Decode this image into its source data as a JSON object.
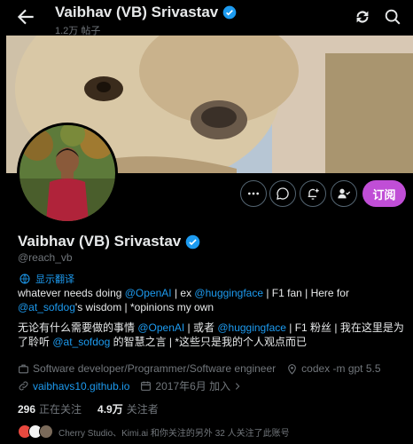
{
  "header": {
    "title": "Vaibhav (VB) Srivastav",
    "post_count": "1.2万 帖子",
    "accent": "#1d9bf0"
  },
  "profile": {
    "name": "Vaibhav (VB) Srivastav",
    "handle": "@reach_vb",
    "translate_label": "显示翻译",
    "subscribe_label": "订阅",
    "subscribe_color": "#c04ed6"
  },
  "bio_en": {
    "p1": "whatever needs doing ",
    "l1": "@OpenAI",
    "p2": " | ex ",
    "l2": "@huggingface",
    "p3": " | F1 fan | Here for ",
    "l3": "@at_sofdog",
    "p4": "'s wisdom | *opinions my own"
  },
  "bio_zh": {
    "p1": "无论有什么需要做的事情 ",
    "l1": "@OpenAI",
    "p2": " | 或者 ",
    "l2": "@huggingface",
    "p3": " | F1 粉丝 | 我在这里是为了聆听 ",
    "l3": "@at_sofdog",
    "p4": " 的智慧之言 | *这些只是我的个人观点而已"
  },
  "meta": {
    "occupation": "Software developer/Programmer/Software engineer",
    "location": "codex -m gpt 5.5",
    "website": "vaibhavs10.github.io",
    "joined": "2017年6月 加入"
  },
  "stats": {
    "following_count": "296",
    "following_label": "正在关注",
    "followers_count": "4.9万",
    "followers_label": "关注者"
  },
  "mutual": {
    "text": "Cherry Studio、Kimi.ai 和你关注的另外 32 人关注了此账号"
  }
}
